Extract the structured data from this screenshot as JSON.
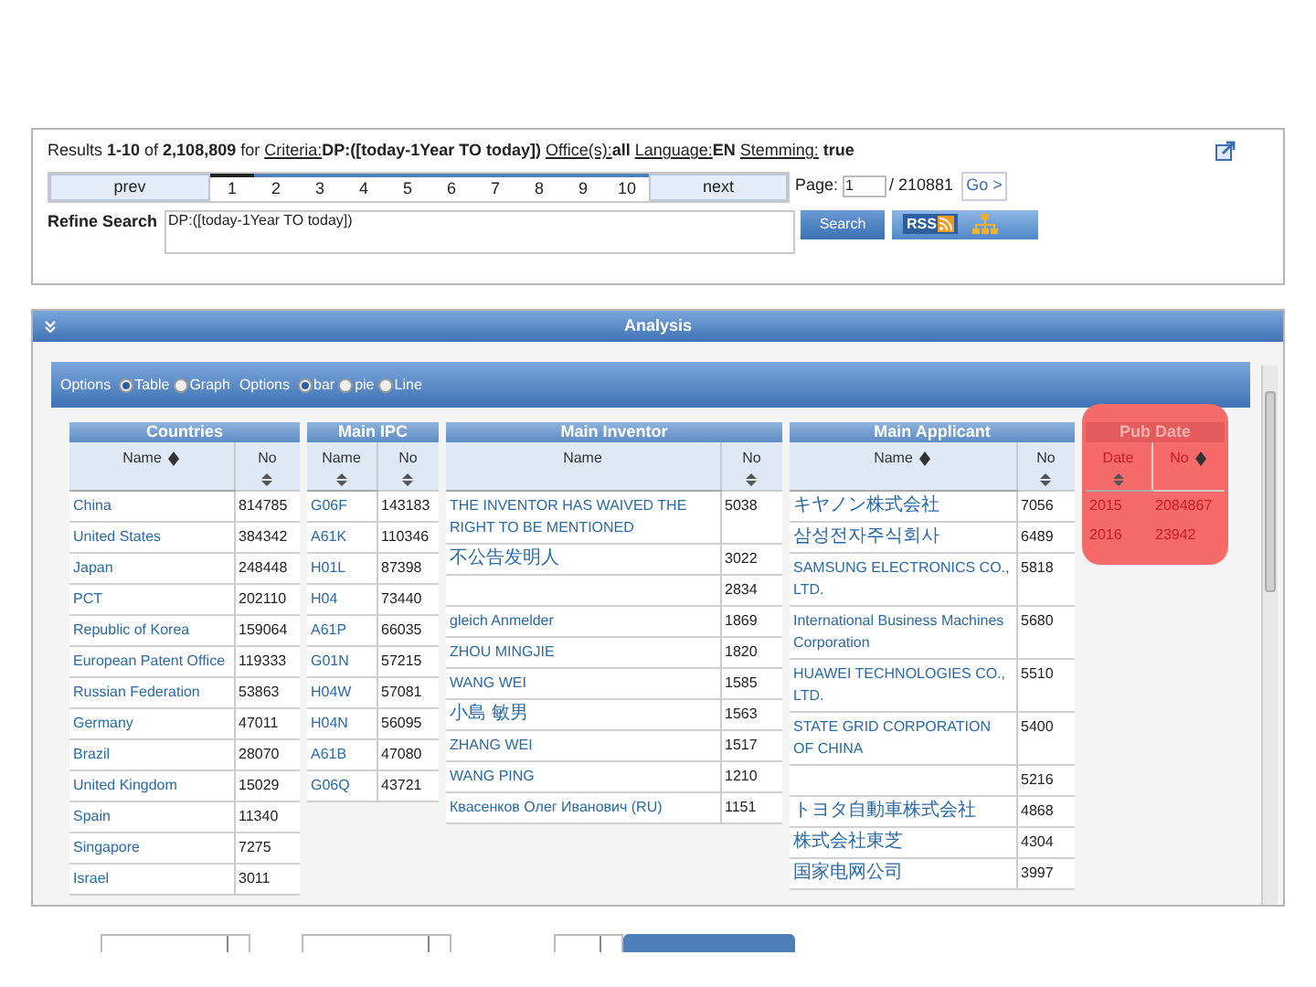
{
  "results": {
    "segments": [
      {
        "kind": "text",
        "text": "Results "
      },
      {
        "kind": "bold",
        "text": "1-10"
      },
      {
        "kind": "text",
        "text": " of "
      },
      {
        "kind": "bold",
        "text": "2,108,809"
      },
      {
        "kind": "text",
        "text": " for "
      },
      {
        "kind": "link",
        "text": "Criteria:"
      },
      {
        "kind": "bold",
        "text": "DP:([today-1Year TO today]) "
      },
      {
        "kind": "link",
        "text": "Office(s):"
      },
      {
        "kind": "bold",
        "text": "all "
      },
      {
        "kind": "link",
        "text": "Language:"
      },
      {
        "kind": "bold",
        "text": "EN "
      },
      {
        "kind": "link",
        "text": "Stemming:"
      },
      {
        "kind": "bold",
        "text": " true"
      }
    ]
  },
  "pagination": {
    "prev": "prev",
    "next": "next",
    "pages": [
      {
        "label": "1",
        "selected": true
      },
      {
        "label": "2",
        "selected": false
      },
      {
        "label": "3",
        "selected": false
      },
      {
        "label": "4",
        "selected": false
      },
      {
        "label": "5",
        "selected": false
      },
      {
        "label": "6",
        "selected": false
      },
      {
        "label": "7",
        "selected": false
      },
      {
        "label": "8",
        "selected": false
      },
      {
        "label": "9",
        "selected": false
      },
      {
        "label": "10",
        "selected": false
      }
    ],
    "page_label": "Page:",
    "page_value": "1",
    "page_total": "/ 210881",
    "go": "Go >"
  },
  "refine": {
    "label": "Refine Search",
    "value": "DP:([today-1Year TO today])",
    "button": "Search",
    "rss": "RSS"
  },
  "analysis": {
    "title": "Analysis",
    "option_groups": [
      {
        "label": "Options",
        "choices": [
          {
            "label": "Table",
            "selected": true
          },
          {
            "label": "Graph",
            "selected": false
          }
        ]
      },
      {
        "label": "Options",
        "choices": [
          {
            "label": "bar",
            "selected": true
          },
          {
            "label": "pie",
            "selected": false
          },
          {
            "label": "Line",
            "selected": false
          }
        ]
      }
    ],
    "tables": [
      {
        "title": "Countries",
        "highlighted": false,
        "columns": [
          {
            "label": "Name",
            "kind": "sorted"
          },
          {
            "label": "No",
            "kind": "sortable"
          }
        ],
        "rows": [
          {
            "name": "China",
            "no": "814785"
          },
          {
            "name": "United States",
            "no": "384342"
          },
          {
            "name": "Japan",
            "no": "248448"
          },
          {
            "name": "PCT",
            "no": "202110"
          },
          {
            "name": "Republic of Korea",
            "no": "159064"
          },
          {
            "name": "European Patent Office",
            "no": "119333"
          },
          {
            "name": "Russian Federation",
            "no": "53863"
          },
          {
            "name": "Germany",
            "no": "47011"
          },
          {
            "name": "Brazil",
            "no": "28070"
          },
          {
            "name": "United Kingdom",
            "no": "15029"
          },
          {
            "name": "Spain",
            "no": "11340"
          },
          {
            "name": "Singapore",
            "no": "7275"
          },
          {
            "name": "Israel",
            "no": "3011"
          }
        ]
      },
      {
        "title": "Main IPC",
        "highlighted": false,
        "columns": [
          {
            "label": "Name",
            "kind": "sortable"
          },
          {
            "label": "No",
            "kind": "sortable"
          }
        ],
        "rows": [
          {
            "name": "G06F",
            "no": "143183"
          },
          {
            "name": "A61K",
            "no": "110346"
          },
          {
            "name": "H01L",
            "no": "87398"
          },
          {
            "name": "H04",
            "no": "73440"
          },
          {
            "name": "A61P",
            "no": "66035"
          },
          {
            "name": "G01N",
            "no": "57215"
          },
          {
            "name": "H04W",
            "no": "57081"
          },
          {
            "name": "H04N",
            "no": "56095"
          },
          {
            "name": "A61B",
            "no": "47080"
          },
          {
            "name": "G06Q",
            "no": "43721"
          }
        ]
      },
      {
        "title": "Main Inventor",
        "highlighted": false,
        "columns": [
          {
            "label": "Name"
          },
          {
            "label": "No",
            "kind": "sortable"
          }
        ],
        "rows": [
          {
            "name": "THE INVENTOR HAS WAIVED THE RIGHT TO BE MENTIONED",
            "no": "5038"
          },
          {
            "name": "不公告发明人",
            "no": "3022"
          },
          {
            "no": "2834"
          },
          {
            "name": "gleich Anmelder",
            "no": "1869"
          },
          {
            "name": "ZHOU MINGJIE",
            "no": "1820"
          },
          {
            "name": "WANG WEI",
            "no": "1585"
          },
          {
            "name": "小島 敏男",
            "no": "1563"
          },
          {
            "name": "ZHANG WEI",
            "no": "1517"
          },
          {
            "name": "WANG PING",
            "no": "1210"
          },
          {
            "name": "Квасенков Олег Иванович (RU)",
            "no": "1151"
          }
        ]
      },
      {
        "title": "Main Applicant",
        "highlighted": false,
        "columns": [
          {
            "label": "Name",
            "kind": "sorted"
          },
          {
            "label": "No",
            "kind": "sortable"
          }
        ],
        "rows": [
          {
            "name": "キヤノン株式会社",
            "no": "7056"
          },
          {
            "name": "삼성전자주식회사",
            "no": "6489"
          },
          {
            "name": "SAMSUNG ELECTRONICS CO., LTD.",
            "no": "5818"
          },
          {
            "name": "International Business Machines Corporation",
            "no": "5680"
          },
          {
            "name": "HUAWEI TECHNOLOGIES CO., LTD.",
            "no": "5510"
          },
          {
            "name": "STATE GRID CORPORATION OF CHINA",
            "no": "5400"
          },
          {
            "no": "5216"
          },
          {
            "name": "トヨタ自動車株式会社",
            "no": "4868"
          },
          {
            "name": "株式会社東芝",
            "no": "4304"
          },
          {
            "name": "国家电网公司",
            "no": "3997"
          }
        ]
      },
      {
        "title": "Pub Date",
        "highlighted": true,
        "columns": [
          {
            "label": "Date",
            "kind": "sortable"
          },
          {
            "label": "No",
            "kind": "sorted"
          }
        ],
        "rows": [
          {
            "name": "2015",
            "no": "2084867"
          },
          {
            "name": "2016",
            "no": "23942"
          }
        ]
      }
    ]
  }
}
